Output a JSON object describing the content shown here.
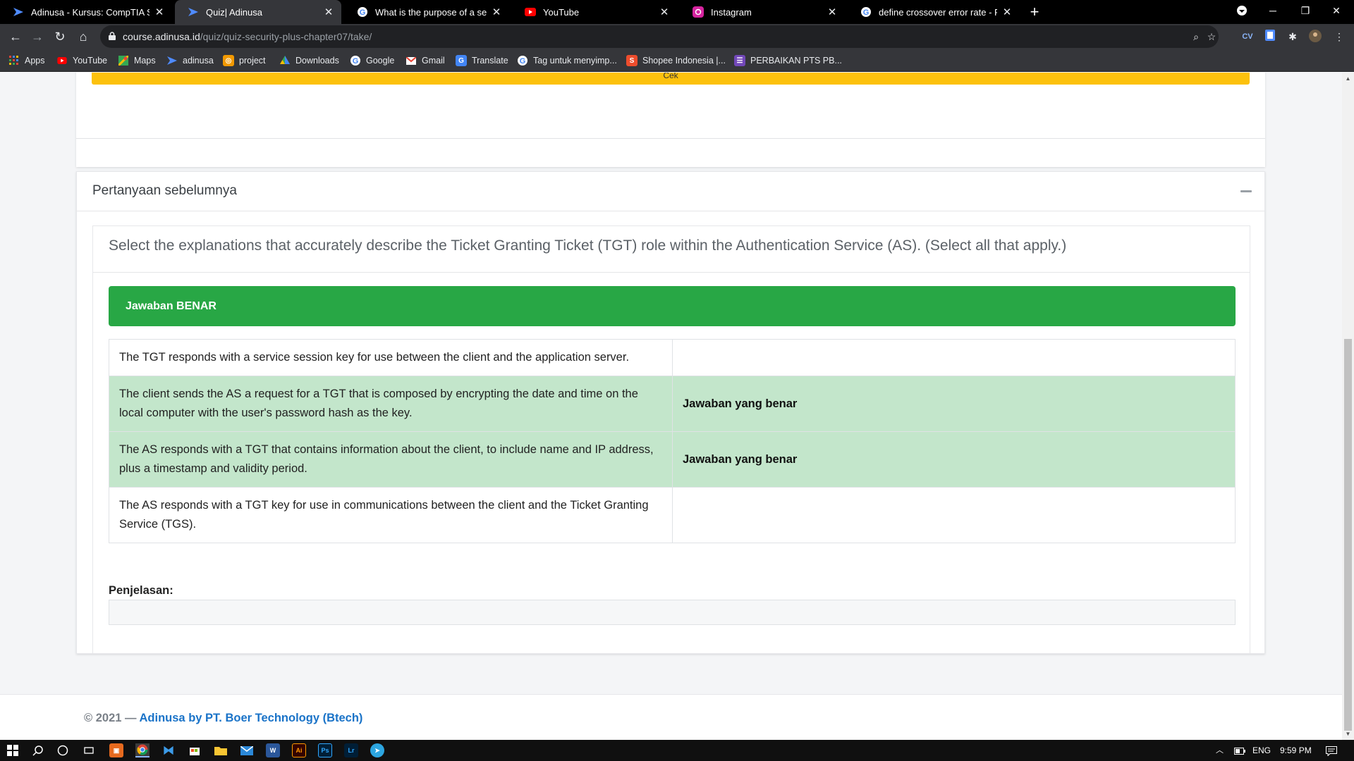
{
  "browser": {
    "tabs": [
      {
        "title": "Adinusa - Kursus: CompTIA Secur",
        "icon": "adinusa-icon",
        "active": false
      },
      {
        "title": "Quiz| Adinusa",
        "icon": "adinusa-icon",
        "active": true
      },
      {
        "title": "What is the purpose of a server c",
        "icon": "google-icon",
        "active": false
      },
      {
        "title": "YouTube",
        "icon": "youtube-icon",
        "active": false
      },
      {
        "title": "Instagram",
        "icon": "instagram-icon",
        "active": false
      },
      {
        "title": "define crossover error rate - Pen",
        "icon": "google-icon",
        "active": false
      }
    ],
    "url_host": "course.adinusa.id",
    "url_path": "/quiz/quiz-security-plus-chapter07/take/",
    "bookmarks": [
      {
        "label": "Apps",
        "icon": "apps-grid-icon"
      },
      {
        "label": "YouTube",
        "icon": "youtube-icon"
      },
      {
        "label": "Maps",
        "icon": "maps-icon"
      },
      {
        "label": "adinusa",
        "icon": "adinusa-icon"
      },
      {
        "label": "project",
        "icon": "project-icon"
      },
      {
        "label": "Downloads",
        "icon": "downloads-icon"
      },
      {
        "label": "Google",
        "icon": "google-icon"
      },
      {
        "label": "Gmail",
        "icon": "gmail-icon"
      },
      {
        "label": "Translate",
        "icon": "translate-icon"
      },
      {
        "label": "Tag untuk menyimp...",
        "icon": "google-icon"
      },
      {
        "label": "Shopee Indonesia |...",
        "icon": "shopee-icon"
      },
      {
        "label": "PERBAIKAN PTS PB...",
        "icon": "forms-icon"
      }
    ]
  },
  "page": {
    "prev_button_label": "Cek",
    "section_title": "Pertanyaan sebelumnya",
    "question": "Select the explanations that accurately describe the Ticket Granting Ticket (TGT) role within the Authentication Service (AS). (Select all that apply.)",
    "result_banner": "Jawaban BENAR",
    "answers": [
      {
        "text": "The TGT responds with a service session key for use between the client and the application server.",
        "mark": "",
        "correct": false
      },
      {
        "text": "The client sends the AS a request for a TGT that is composed by encrypting the date and time on the local computer with the user's password hash as the key.",
        "mark": "Jawaban yang benar",
        "correct": true
      },
      {
        "text": "The AS responds with a TGT that contains information about the client, to include name and IP address, plus a timestamp and validity period.",
        "mark": "Jawaban yang benar",
        "correct": true
      },
      {
        "text": "The AS responds with a TGT key for use in communications between the client and the Ticket Granting Service (TGS).",
        "mark": "",
        "correct": false
      }
    ],
    "explanation_label": "Penjelasan:",
    "explanation_text": "",
    "footer_prefix": "© 2021 — ",
    "footer_brand": "Adinusa by PT. Boer Technology (Btech)"
  },
  "taskbar": {
    "language": "ENG",
    "time": "9:59 PM"
  },
  "colors": {
    "success": "#28a745",
    "correct_row": "#c3e6cb",
    "warning": "#fcc10d",
    "brand_link": "#1a73c8"
  }
}
